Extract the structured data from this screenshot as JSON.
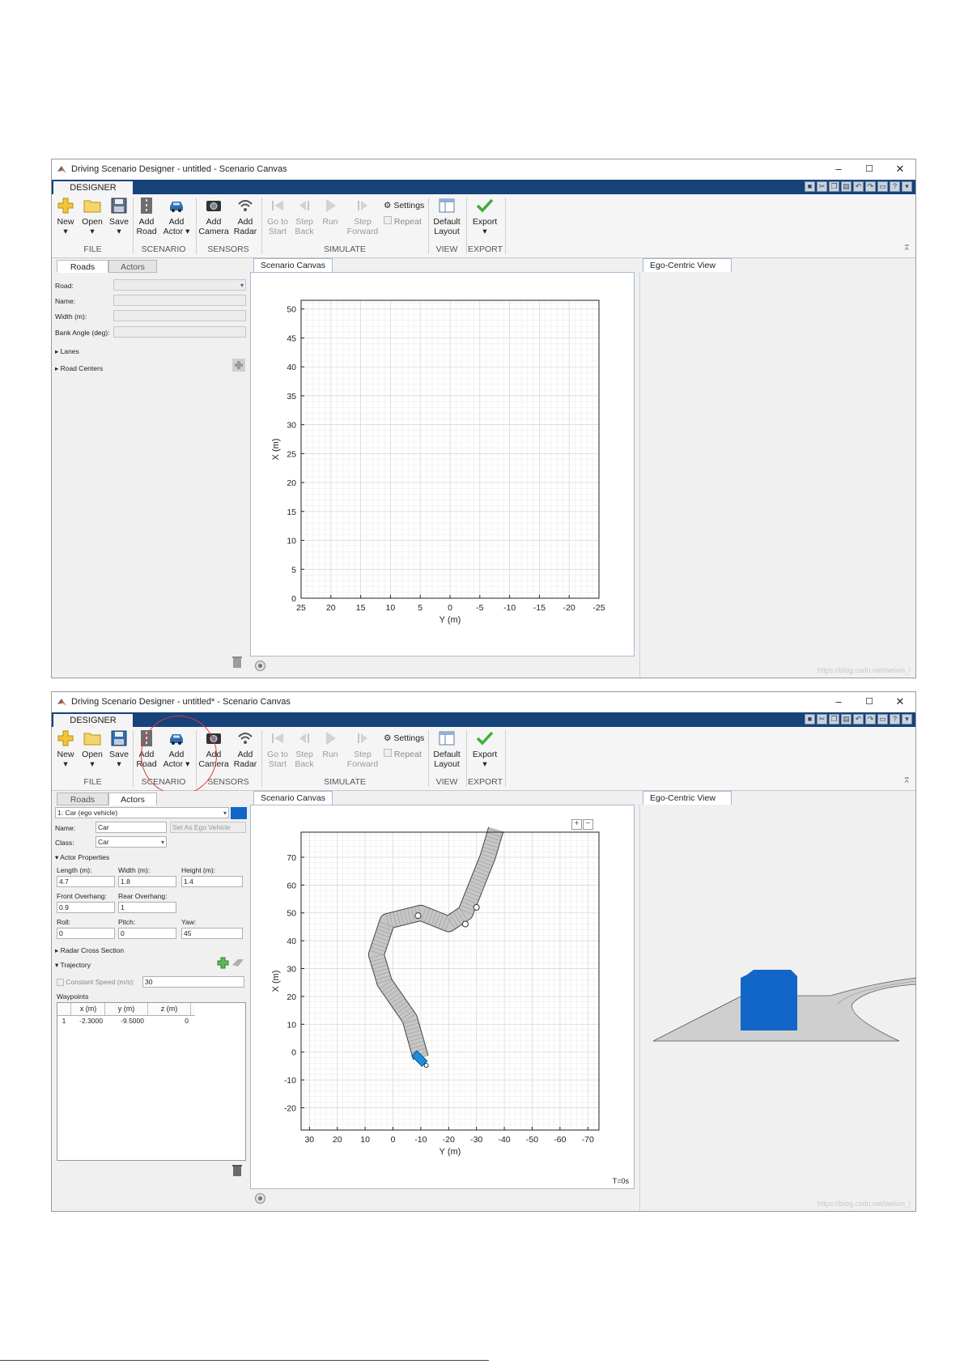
{
  "window1": {
    "title": "Driving Scenario Designer - untitled - Scenario Canvas",
    "window_controls": [
      "–",
      "☐",
      "✕"
    ],
    "ribbon_tab": "DESIGNER",
    "ribbon": {
      "new": "New",
      "open": "Open",
      "save": "Save",
      "add_road_1": "Add",
      "add_road_2": "Road",
      "add_actor_1": "Add",
      "add_actor_2": "Actor ▾",
      "add_camera_1": "Add",
      "add_camera_2": "Camera",
      "add_radar_1": "Add",
      "add_radar_2": "Radar",
      "goto_start_1": "Go to",
      "goto_start_2": "Start",
      "step_back_1": "Step",
      "step_back_2": "Back",
      "run": "Run",
      "step_forward_1": "Step",
      "step_forward_2": "Forward",
      "settings": "Settings",
      "repeat": "Repeat",
      "default_layout_1": "Default",
      "default_layout_2": "Layout",
      "export": "Export",
      "sections": {
        "file": "FILE",
        "scenario": "SCENARIO",
        "sensors": "SENSORS",
        "simulate": "SIMULATE",
        "view": "VIEW",
        "export": "EXPORT"
      }
    },
    "left_tabs": {
      "roads": "Roads",
      "actors": "Actors"
    },
    "roads_panel": {
      "road_label": "Road:",
      "name_label": "Name:",
      "width_label": "Width (m):",
      "bank_label": "Bank Angle (deg):",
      "lanes": "▸ Lanes",
      "road_centers": "▸ Road Centers"
    },
    "canvas_tab": "Scenario Canvas",
    "ego_tab": "Ego-Centric View",
    "watermark": "https://blog.csdn.net/weixin_l"
  },
  "window2": {
    "title": "Driving Scenario Designer - untitled* - Scenario Canvas",
    "actors_panel": {
      "actor_select": "1: Car (ego vehicle)",
      "actor_color": "#1266c8",
      "name_label": "Name:",
      "name_value": "Car",
      "set_ego": "Set As Ego Vehicle",
      "class_label": "Class:",
      "class_value": "Car",
      "actor_properties": "▾ Actor Properties",
      "length_label": "Length (m):",
      "length_value": "4.7",
      "width_label": "Width (m):",
      "width_value": "1.8",
      "height_label": "Height (m):",
      "height_value": "1.4",
      "front_overhang_label": "Front Overhang:",
      "front_overhang_value": "0.9",
      "rear_overhang_label": "Rear Overhang:",
      "rear_overhang_value": "1",
      "roll_label": "Roll:",
      "roll_value": "0",
      "pitch_label": "Pitch:",
      "pitch_value": "0",
      "yaw_label": "Yaw:",
      "yaw_value": "45",
      "radar_cross_section": "▸ Radar Cross Section",
      "trajectory": "▾ Trajectory",
      "constant_speed_label": "Constant Speed (m/s):",
      "constant_speed_value": "30",
      "waypoints_label": "Waypoints",
      "waypoint_headers": [
        "x (m)",
        "y (m)",
        "z (m)"
      ],
      "waypoints": [
        {
          "idx": "1",
          "x": "-2.3000",
          "y": "-9.5000",
          "z": "0"
        }
      ]
    },
    "time_label": "T=0s",
    "zoom_in": "+",
    "zoom_out": "−",
    "watermark": "https://blog.csdn.net/weixin_l"
  },
  "chart_data": [
    {
      "type": "scatter",
      "title": "",
      "xlabel": "Y (m)",
      "ylabel": "X (m)",
      "x_ticks": [
        25,
        20,
        15,
        10,
        5,
        0,
        -5,
        -10,
        -15,
        -20,
        -25
      ],
      "y_ticks": [
        0,
        5,
        10,
        15,
        20,
        25,
        30,
        35,
        40,
        45,
        50
      ],
      "xlim": [
        25,
        -25
      ],
      "ylim": [
        0,
        51.5
      ],
      "grid": true
    },
    {
      "type": "scatter",
      "title": "",
      "xlabel": "Y (m)",
      "ylabel": "X (m)",
      "x_ticks": [
        30,
        20,
        10,
        0,
        -10,
        -20,
        -30,
        -40,
        -50,
        -60,
        -70
      ],
      "y_ticks": [
        -20,
        -10,
        0,
        10,
        20,
        30,
        40,
        50,
        60,
        70
      ],
      "xlim": [
        33,
        -74
      ],
      "ylim": [
        -28,
        79
      ],
      "grid": true,
      "road_centers": [
        [
          -10,
          -2
        ],
        [
          -6,
          12
        ],
        [
          3,
          25
        ],
        [
          6,
          35
        ],
        [
          2,
          47
        ],
        [
          -10,
          50
        ],
        [
          -20,
          46
        ],
        [
          -26,
          50
        ],
        [
          -30,
          60
        ],
        [
          -34,
          70
        ],
        [
          -37,
          80
        ]
      ],
      "road_waypoints": [
        {
          "y": -9,
          "x": 49
        },
        {
          "y": -26,
          "x": 46
        },
        {
          "y": -30,
          "x": 52
        }
      ],
      "ego_vehicle": {
        "y": -9.5,
        "x": -2.3,
        "yaw": 45
      }
    }
  ]
}
